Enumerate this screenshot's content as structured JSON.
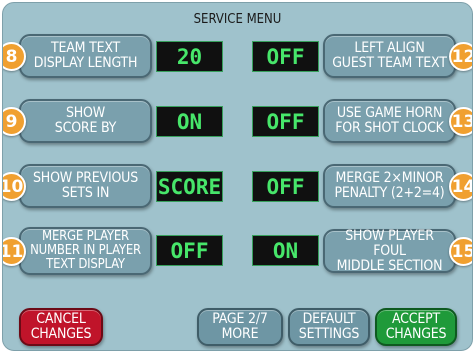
{
  "title": "SERVICE MENU",
  "options": [
    {
      "number": "8",
      "label": "TEAM TEXT\nDISPLAY LENGTH",
      "value": "20"
    },
    {
      "number": "9",
      "label": "SHOW\nSCORE BY",
      "value": "ON"
    },
    {
      "number": "10",
      "label": "SHOW PREVIOUS\nSETS IN",
      "value": "SCORE"
    },
    {
      "number": "11",
      "label": "MERGE PLAYER\nNUMBER IN PLAYER\nTEXT DISPLAY",
      "value": "OFF"
    },
    {
      "number": "12",
      "label": "LEFT ALIGN\nGUEST TEAM TEXT",
      "value": "OFF"
    },
    {
      "number": "13",
      "label": "USE GAME HORN\nFOR SHOT CLOCK",
      "value": "OFF"
    },
    {
      "number": "14",
      "label": "MERGE 2×MINOR\nPENALTY (2+2=4)",
      "value": "OFF"
    },
    {
      "number": "15",
      "label": "SHOW PLAYER FOUL\nMIDDLE SECTION",
      "value": "ON"
    }
  ],
  "footer": {
    "cancel": "CANCEL\nCHANGES",
    "page": "PAGE 2/7\nMORE",
    "default": "DEFAULT\nSETTINGS",
    "accept": "ACCEPT\nCHANGES"
  },
  "colors": {
    "background": "#9fc2cc",
    "button": "#7aa0ad",
    "value_text": "#47e66a",
    "badge": "#f0a030",
    "cancel": "#c0142a",
    "accept": "#1f9a3a"
  }
}
